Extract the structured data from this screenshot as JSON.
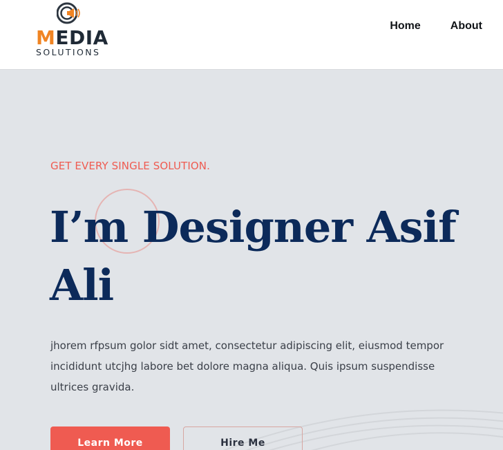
{
  "logo": {
    "word_accent": "M",
    "word_rest": "EDIA",
    "sub": "SOLUTIONS",
    "mark_icon": "c-megaphone-icon",
    "accent_color": "#f08423"
  },
  "nav": {
    "items": [
      {
        "label": "Home"
      },
      {
        "label": "About"
      }
    ]
  },
  "hero": {
    "tagline": "GET EVERY SINGLE SOLUTION.",
    "title": "I’m Designer Asif Ali",
    "description": "jhorem rfpsum golor sidt amet, consectetur adipiscing elit, eiusmod tempor incididunt utcjhg labore bet dolore magna aliqua. Quis ipsum suspendisse ultrices gravida.",
    "primary_button": "Learn More",
    "secondary_button": "Hire Me"
  },
  "colors": {
    "accent": "#ef5b51",
    "title": "#0c2a5a",
    "background": "#e1e4e8"
  }
}
